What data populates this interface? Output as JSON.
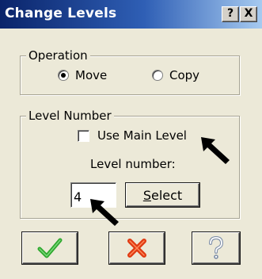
{
  "window": {
    "title": "Change Levels",
    "help_button": "?",
    "close_button": "X"
  },
  "operation": {
    "label": "Operation",
    "options": [
      {
        "label": "Move",
        "selected": true
      },
      {
        "label": "Copy",
        "selected": false
      }
    ]
  },
  "level_number": {
    "label": "Level Number",
    "use_main_level_label": "Use Main Level",
    "use_main_level_checked": false,
    "level_number_label": "Level number:",
    "level_value": "4",
    "select_label": "Select"
  },
  "buttons": {
    "ok_icon": "checkmark-icon",
    "cancel_icon": "x-icon",
    "help_icon": "question-icon"
  },
  "colors": {
    "title_bar": "#0a246a",
    "ok_green": "#2ea82e",
    "cancel_red": "#e03a12"
  }
}
